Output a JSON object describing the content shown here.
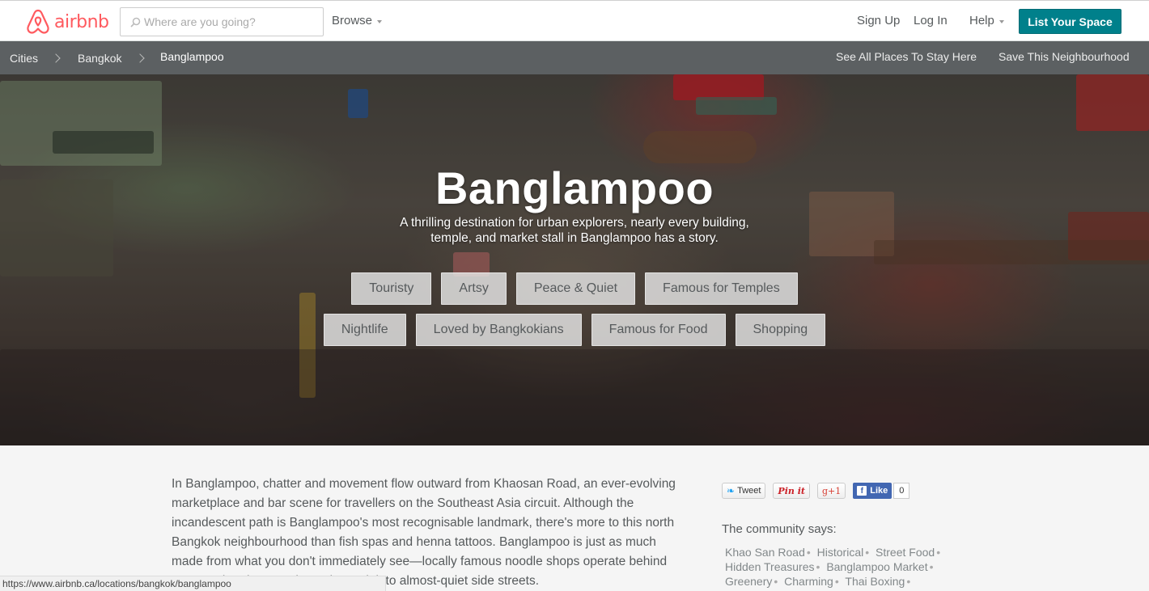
{
  "header": {
    "brand": "airbnb",
    "search_placeholder": "Where are you going?",
    "browse_label": "Browse",
    "signup_label": "Sign Up",
    "login_label": "Log In",
    "help_label": "Help",
    "list_space_label": "List Your Space",
    "brand_color": "#ff5a5f",
    "accent_color": "#00808b"
  },
  "breadcrumb": {
    "items": [
      "Cities",
      "Bangkok",
      "Banglampoo"
    ],
    "see_all_label": "See All Places To Stay Here",
    "save_label": "Save This Neighbourhood"
  },
  "hero": {
    "title": "Banglampoo",
    "subtitle": "A thrilling destination for urban explorers, nearly every building, temple, and market stall in Banglampoo has a story.",
    "tags_row1": [
      "Touristy",
      "Artsy",
      "Peace & Quiet",
      "Famous for Temples"
    ],
    "tags_row2": [
      "Nightlife",
      "Loved by Bangkokians",
      "Famous for Food",
      "Shopping"
    ]
  },
  "article": {
    "text": "In Banglampoo, chatter and movement flow outward from Khaosan Road, an ever-evolving marketplace and bar scene for travellers on the Southeast Asia circuit. Although the incandescent path is Banglampoo's most recognisable landmark, there's more to this north Bangkok neighbourhood than fish spas and henna tattoos. Banglampoo is just as much made from what you don't immediately see—locally famous noodle shops operate behind unassuming doors and temples tuck into almost-quiet side streets."
  },
  "social": {
    "tweet_label": "Tweet",
    "pin_label": "Pin it",
    "gplus_label": "g+1",
    "like_label": "Like",
    "like_count": "0"
  },
  "community": {
    "heading": "The community says:",
    "tags": [
      "Khao San Road",
      "Historical",
      "Street Food",
      "Hidden Treasures",
      "Banglampoo Market",
      "Greenery",
      "Charming",
      "Thai Boxing"
    ]
  },
  "statusbar": {
    "url": "https://www.airbnb.ca/locations/bangkok/banglampoo"
  }
}
